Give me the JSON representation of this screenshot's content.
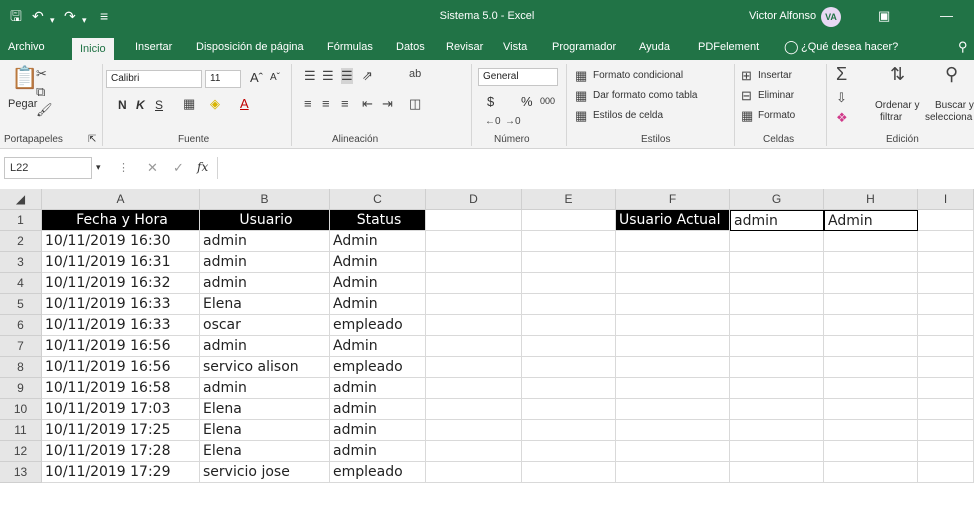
{
  "titlebar": {
    "title": "Sistema 5.0  -  Excel",
    "user_name": "Victor Alfonso",
    "user_initials": "VA",
    "icons": [
      "save-icon",
      "undo-icon",
      "redo-icon",
      "customize-qat-icon",
      "ribbon-display-icon",
      "minimize-icon"
    ]
  },
  "tabs": [
    "Archivo",
    "Inicio",
    "Insertar",
    "Disposición de página",
    "Fórmulas",
    "Datos",
    "Revisar",
    "Vista",
    "Programador",
    "Ayuda",
    "PDFelement"
  ],
  "active_tab": "Inicio",
  "tell_me": "¿Qué desea hacer?",
  "ribbon": {
    "clipboard": {
      "paste": "Pegar",
      "label": "Portapapeles"
    },
    "font": {
      "name": "Calibri",
      "size": "11",
      "bold": "N",
      "italic": "K",
      "underline": "S",
      "label": "Fuente"
    },
    "alignment": {
      "label": "Alineación"
    },
    "number": {
      "format": "General",
      "currency": "$",
      "percent": "%",
      "thousands": "000",
      "label": "Número"
    },
    "styles": {
      "conditional": "Formato condicional",
      "table": "Dar formato como tabla",
      "cell_styles": "Estilos de celda",
      "label": "Estilos"
    },
    "cells": {
      "insert": "Insertar",
      "delete": "Eliminar",
      "format": "Formato",
      "label": "Celdas"
    },
    "editing": {
      "sort_1": "Ordenar y",
      "sort_2": "filtrar",
      "find_1": "Buscar y",
      "find_2": "selecciona",
      "label": "Edición"
    }
  },
  "formula_bar": {
    "name_box": "L22",
    "fx": "fx",
    "content": ""
  },
  "sheet": {
    "columns": [
      "A",
      "B",
      "C",
      "D",
      "E",
      "F",
      "G",
      "H",
      "I"
    ],
    "row_numbers": [
      "1",
      "2",
      "3",
      "4",
      "5",
      "6",
      "7",
      "8",
      "9",
      "10",
      "11",
      "12",
      "13"
    ],
    "header": [
      "Fecha y Hora",
      "Usuario",
      "Status"
    ],
    "rows": [
      [
        "10/11/2019 16:30",
        "admin",
        "Admin"
      ],
      [
        "10/11/2019 16:31",
        "admin",
        "Admin"
      ],
      [
        "10/11/2019 16:32",
        "admin",
        "Admin"
      ],
      [
        "10/11/2019 16:33",
        "Elena",
        "Admin"
      ],
      [
        "10/11/2019 16:33",
        "oscar",
        "empleado"
      ],
      [
        "10/11/2019 16:56",
        "admin",
        "Admin"
      ],
      [
        "10/11/2019 16:56",
        "servico alison",
        "empleado"
      ],
      [
        "10/11/2019 16:58",
        "admin",
        "admin"
      ],
      [
        "10/11/2019 17:03",
        "Elena",
        "admin"
      ],
      [
        "10/11/2019 17:25",
        "Elena",
        "admin"
      ],
      [
        "10/11/2019 17:28",
        "Elena",
        "admin"
      ],
      [
        "10/11/2019 17:29",
        "servicio jose",
        "empleado"
      ]
    ],
    "current_user": {
      "label": "Usuario Actual",
      "value": "admin",
      "role": "Admin"
    }
  },
  "colors": {
    "excel_green": "#217346",
    "header_fill": "#000000"
  }
}
